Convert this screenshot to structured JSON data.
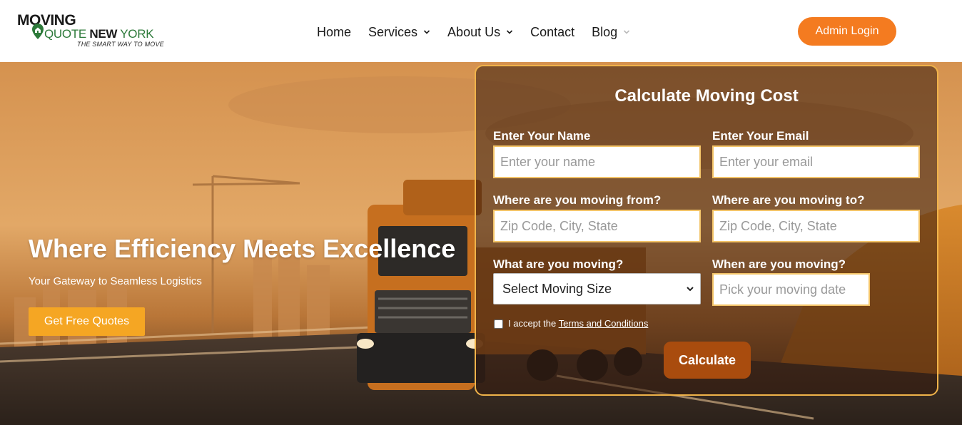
{
  "logo": {
    "line1": "MOVING",
    "line2_a": "QUOTE ",
    "line2_b": "NEW",
    "line2_c": " YORK",
    "tagline": "THE SMART WAY TO MOVE"
  },
  "nav": {
    "items": [
      {
        "label": "Home",
        "dropdown": false
      },
      {
        "label": "Services",
        "dropdown": true
      },
      {
        "label": "About Us",
        "dropdown": true
      },
      {
        "label": "Contact",
        "dropdown": false
      },
      {
        "label": "Blog",
        "dropdown": true
      }
    ]
  },
  "header": {
    "admin_label": "Admin Login",
    "admin_color": "#f47b20"
  },
  "hero": {
    "title": "Where Efficiency Meets Excellence",
    "subtitle": "Your Gateway to Seamless Logistics",
    "cta_label": "Get Free Quotes",
    "cta_color": "#f5a623"
  },
  "form": {
    "title": "Calculate Moving Cost",
    "name_label": "Enter Your Name",
    "name_placeholder": "Enter your name",
    "email_label": "Enter Your Email",
    "email_placeholder": "Enter your email",
    "from_label": "Where are you moving from?",
    "from_placeholder": "Zip Code, City, State",
    "to_label": "Where are you moving to?",
    "to_placeholder": "Zip Code, City, State",
    "what_label": "What are you moving?",
    "what_selected": "Select Moving Size",
    "when_label": "When are you moving?",
    "when_placeholder": "Pick your moving date",
    "terms_prefix": "I accept the ",
    "terms_link": "Terms and Conditions",
    "submit_label": "Calculate",
    "border_color": "#f0b34a",
    "submit_color": "#a94c0e"
  }
}
